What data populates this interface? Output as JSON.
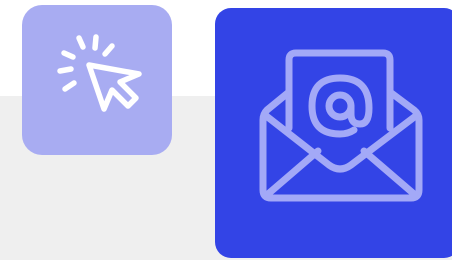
{
  "colors": {
    "background_top": "#ffffff",
    "background_bottom": "#efefef",
    "click_tile_bg": "#a8acf2",
    "click_icon": "#ffffff",
    "mail_tile_bg": "#3344e6",
    "mail_icon": "#a3a9f7"
  },
  "icons": {
    "click_tile": "cursor-click-icon",
    "mail_tile": "open-envelope-at-sign-icon"
  }
}
